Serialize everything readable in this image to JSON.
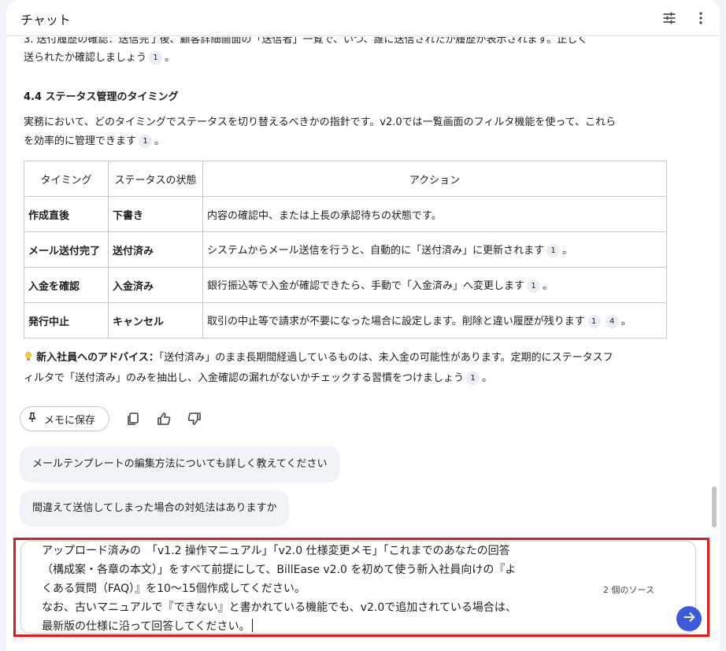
{
  "header": {
    "title": "チャット",
    "icons": [
      "tune-icon",
      "more-vert-icon"
    ]
  },
  "content": {
    "cut_line": "3. 送付履歴の確認：送信完了後、顧客詳細画面の「送信者」一覧で、いつ、誰に送信されたか履歴が表示されます。正しく",
    "cut_line_2": "送られたか確認しましょう",
    "cut_line_2_cite": "1",
    "section_heading": "4.4 ステータス管理のタイミング",
    "intro_line1": "実務において、どのタイミングでステータスを切り替えるべきかの指針です。v2.0では一覧画面のフィルタ機能を使って、これら",
    "intro_line2": "を効率的に管理できます",
    "intro_cite": "1",
    "table": {
      "headers": [
        "タイミング",
        "ステータスの状態",
        "アクション"
      ],
      "rows": [
        {
          "timing": "作成直後",
          "status": "下書き",
          "action": "内容の確認中、または上長の承認待ちの状態です。",
          "cites": [],
          "end": ""
        },
        {
          "timing": "メール送付完了",
          "status": "送付済み",
          "action": "システムからメール送信を行うと、自動的に「送付済み」に更新されます",
          "cites": [
            "1"
          ],
          "end": "。"
        },
        {
          "timing": "入金を確認",
          "status": "入金済み",
          "action": "銀行振込等で入金が確認できたら、手動で「入金済み」へ変更します",
          "cites": [
            "1"
          ],
          "end": "。"
        },
        {
          "timing": "発行中止",
          "status": "キャンセル",
          "action": "取引の中止等で請求が不要になった場合に設定します。削除と違い履歴が残ります",
          "cites": [
            "1",
            "4"
          ],
          "end": "。"
        }
      ]
    },
    "advice": {
      "label": "新入社員へのアドバイス：",
      "text1": "「送付済み」のまま長期間経過しているものは、未入金の可能性があります。定期的にステータスフ",
      "text2": "ィルタで「送付済み」のみを抽出し、入金確認の漏れがないかチェックする習慣をつけましょう",
      "cite": "1"
    },
    "actions": {
      "save_label": "メモに保存",
      "icons": [
        "pin-icon",
        "copy-icon",
        "thumb-up-icon",
        "thumb-down-icon"
      ]
    },
    "user_messages": [
      "メールテンプレートの編集方法についても詳しく教えてください",
      "間違えて送信してしまった場合の対処法はありますか"
    ]
  },
  "input": {
    "value": "アップロード済みの　「v1.2 操作マニュアル」「v2.0 仕様変更メモ」「これまでのあなたの回答\n（構成案・各章の本文）」をすべて前提にして、BillEase v2.0 を初めて使う新入社員向けの『よ\nくある質問（FAQ）』を10〜15個作成してください。\nなお、古いマニュアルで『できない』と書かれている機能でも、v2.0で追加されている場合は、\n最新版の仕様に沿って回答してください。",
    "sources": "2 個のソース",
    "send_icon": "arrow-right-icon"
  },
  "colors": {
    "accent": "#3b5bdb",
    "highlight_border": "#e01b1b",
    "bubble": "#f0f4f9"
  }
}
